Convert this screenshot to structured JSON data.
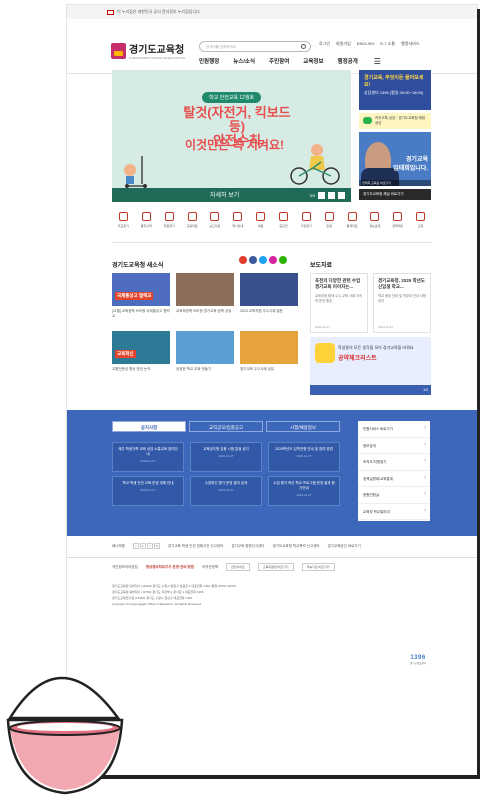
{
  "topbar": {
    "notice": "이 누리집은 대한민국 공식 전자정부 누리집입니다."
  },
  "header": {
    "logo_kr": "경기도교육청",
    "logo_en": "GYEONGGIDO OFFICE OF EDUCATION",
    "search_placeholder": "검색어를 입력하세요",
    "util": [
      "로그인",
      "회원가입",
      "ENGLISH",
      "E-7 소통",
      "행정서비스"
    ],
    "gnb": [
      "민원행정",
      "뉴스/소식",
      "주민참여",
      "교육정보",
      "행정공개"
    ]
  },
  "banner": {
    "tag": "학교 안전교육 12월호",
    "headline1": "탈것(자전거, 킥보드 등)",
    "headline1b": "안전수칙",
    "headline2": "이것만은 꼭 지켜요!",
    "more": "자세히 보기",
    "pager": "3/3",
    "colors": {
      "bg": "#d6ebe4",
      "accent": "#e84c4c",
      "bar": "#1f6b58"
    }
  },
  "side": {
    "blue_title": "경기교육, 무엇이든 물어보세요!",
    "blue_text": "상담센터 1396 (평일 09:00~18:00)",
    "yellow_text": "카카오톡 상담 · 경기도교육청 채팅상담",
    "photo_text1": "경기교육",
    "photo_text2": "임태희입니다.",
    "photo_caption": "임태희 교육감 바로가기",
    "dark": "경기도교육청 채널 바로가기"
  },
  "quick": [
    "학교찾기",
    "통학구역",
    "학원찾기",
    "교육지원",
    "보도자료",
    "행사안내",
    "채용",
    "공모전",
    "기관찾기",
    "민원",
    "통계자료",
    "정보공개",
    "정책제안",
    "규정"
  ],
  "sns": {
    "title": "경기도교육청 새소식",
    "icons": [
      "youtube-icon",
      "facebook-icon",
      "twitter-icon",
      "instagram-icon",
      "blog-icon"
    ],
    "items": [
      {
        "badge": "국제통상고 협력교",
        "cap": "[11월] 교육정책 브리핑 국제통상고 협력교",
        "color": "#4e6dbf"
      },
      {
        "badge": "",
        "cap": "교육부정책 브리핑 경기교육 정책 공유",
        "color": "#8d6e5a"
      },
      {
        "badge": "",
        "cap": "2024 교육지원 우수사례 발표",
        "color": "#39508a"
      },
      {
        "badge": "교육혁신",
        "cap": "교원전문성 향상 방안 논의",
        "color": "#2d7a96"
      },
      {
        "badge": "",
        "cap": "공정한 학교 교육 만들기",
        "color": "#5a9fd4"
      },
      {
        "badge": "",
        "cap": "경기교육 우수사례 공유",
        "color": "#e6a23c"
      }
    ]
  },
  "press": {
    "title": "보도자료",
    "items": [
      {
        "t": "포천의 다양한 관련 수업 경기교육 이어지는...",
        "d": "교육과정 함께 우수 교육 사례 지속적 운영 예정",
        "date": "2024.12.27"
      },
      {
        "t": "경기교육청, 2025 학년도 신입생 학교...",
        "d": "학교 배정 안내 및 학부모 안내 사항 공지",
        "date": "2024.12.27"
      }
    ],
    "promo_top": "학생들의 모든 생각을 모아 경기교육을 바꿔요",
    "promo_main": "공약체크리스트",
    "promo_bottom": "1/3"
  },
  "notice_tabs": [
    "공지사항",
    "교직공모/입찰공고",
    "시험/채용정보"
  ],
  "notices": [
    {
      "t": "제주 학생가족 교육 상담 소통교육 참여안내",
      "d": "2024.12.27"
    },
    {
      "t": "교육공무원 임용 시험 일정 공지",
      "d": "2024.12.27"
    },
    {
      "t": "2025학년도 입학전형 안내 및 참여 방법",
      "d": "2024.12.27"
    },
    {
      "t": "학교 학생 안전 교육 운영 계획 안내",
      "d": "2024.12.27"
    },
    {
      "t": "수업혁신 평가 운영 결과 공개",
      "d": "2024.12.27"
    },
    {
      "t": "수업 평가 혁신 학교 프로그램 운영 결과 평가안내",
      "d": "2024.12.27"
    }
  ],
  "sidemenu": [
    "민원서비스 바로가기",
    "정보공개",
    "조직도/직원찾기",
    "정책실명제/교육통계",
    "종합민원실",
    "교육부 학교알리미",
    "경기도교육청 소개"
  ],
  "linkrow": {
    "label": "배너모음",
    "pages": [
      "<",
      "1",
      ">",
      "II"
    ],
    "links": [
      "경기교육 학생 인권 침해사건 신고센터",
      "경기교육 청렴신고센터",
      "경기도교육청 학교폭력 신고센터",
      "경기교육공간 바로가기"
    ]
  },
  "footer": {
    "links": [
      "개인정보처리방침",
      "영상정보처리기기 운영·관리 방침",
      "저작권정책"
    ],
    "selects": [
      "관련사이트",
      "교육지원청 바로가기",
      "직속기관 바로가기"
    ],
    "info": [
      "경기도교육청 남부청사 (16490) 경기도 수원시 팔달구 효원로 1 대표전화 1396 (평일 09:00~18:00)",
      "경기도교육청 북부청사 (11780) 경기도 의정부시 청사로 1 대표전화 1396",
      "경기도교육연구원 (16381) 경기도 수원시 권선구 대표전화 1396",
      "Copyright (C) Gyeonggido Office of Education. All Rights Reserved."
    ],
    "badge": "1396",
    "badge_sub": "경기교육콜센터"
  }
}
